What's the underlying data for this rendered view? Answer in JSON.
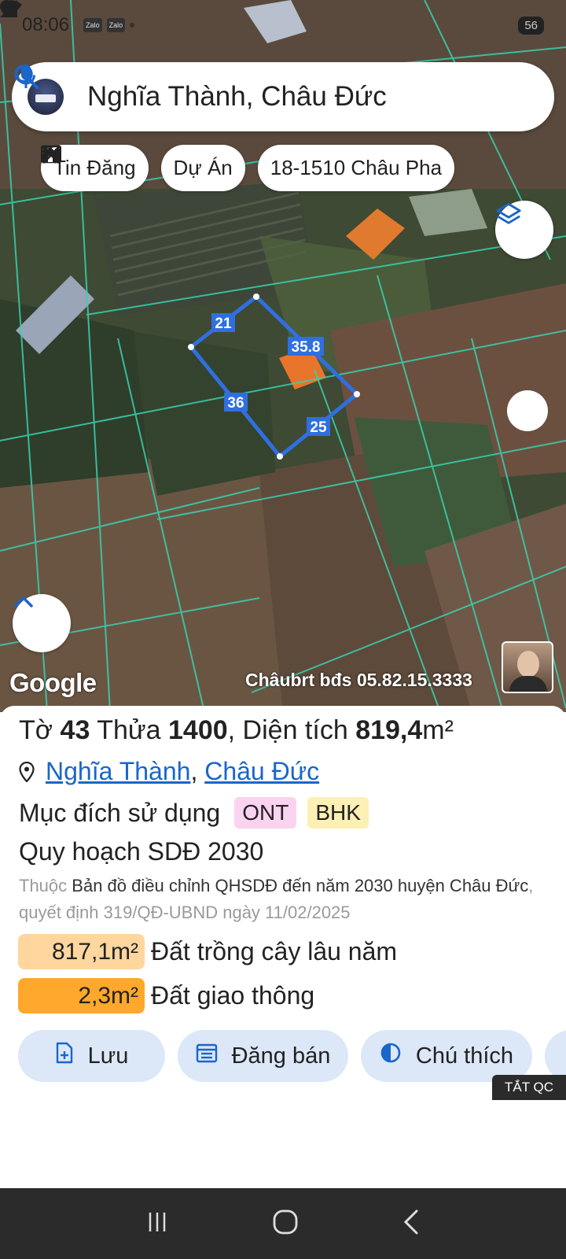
{
  "status_bar": {
    "time": "08:06",
    "app_badges": [
      "Zalo",
      "Zalo"
    ],
    "battery": "56"
  },
  "search": {
    "query": "Nghĩa Thành, Châu Đức"
  },
  "chips": [
    {
      "label": "Tin Đăng",
      "icon": "table-icon"
    },
    {
      "label": "Dự Án",
      "icon": "house-icon"
    },
    {
      "label": "18-1510 Châu Pha",
      "icon": "ruler-icon"
    }
  ],
  "map": {
    "parcel_edges": [
      "21",
      "35.8",
      "36",
      "25"
    ],
    "logo": "Google",
    "watermark": "Châubrt bđs 05.82.15.3333"
  },
  "parcel": {
    "to_label": "Tờ",
    "to_number": "43",
    "thua_label": "Thửa",
    "thua_number": "1400",
    "area_label": ", Diện tích",
    "area_value": "819,4",
    "area_unit": "m²",
    "ward": "Nghĩa Thành",
    "separator": ",",
    "district": "Châu Đức",
    "purpose_label": "Mục đích sử dụng",
    "purpose_badges": [
      "ONT",
      "BHK"
    ],
    "plan_title": "Quy hoạch SDĐ 2030",
    "plan_prefix": "Thuộc",
    "plan_map": "Bản đồ điều chỉnh QHSDĐ đến năm 2030 huyện Châu Đức",
    "plan_decision": ", quyết định 319/QĐ-UBND ngày 11/02/2025",
    "land_use": [
      {
        "area": "817,1m²",
        "label": "Đất trồng cây lâu năm",
        "color": "#ffd69e"
      },
      {
        "area": "2,3m²",
        "label": "Đất giao thông",
        "color": "#ffa82c"
      }
    ]
  },
  "actions": {
    "save": "Lưu",
    "post": "Đăng bán",
    "legend": "Chú thích"
  },
  "ad_off": "TẮT QC",
  "colors": {
    "link": "#1a66c9",
    "action_bg": "#dce7f7",
    "parcel_outline": "#2f6fe0"
  }
}
